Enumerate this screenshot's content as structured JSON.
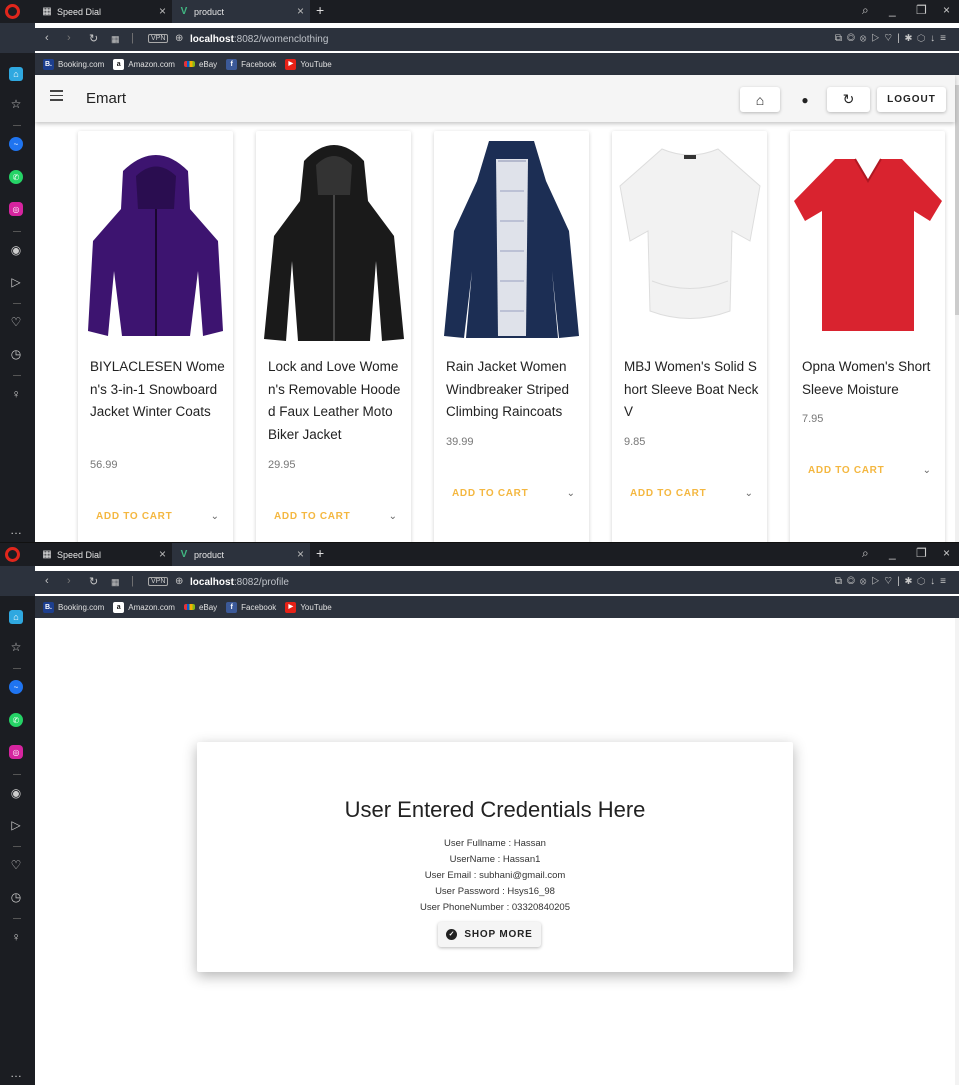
{
  "browser": {
    "tabs": [
      {
        "label": "Speed Dial"
      },
      {
        "label": "product"
      }
    ],
    "bookmarks": [
      {
        "label": "Booking.com",
        "icon": "booking-icon",
        "badge": "B.",
        "color": "#1d3f8f"
      },
      {
        "label": "Amazon.com",
        "icon": "amazon-icon",
        "badge": "a",
        "color": "#ffffff"
      },
      {
        "label": "eBay",
        "icon": "ebay-icon",
        "badge": "",
        "color": "#e2c018"
      },
      {
        "label": "Facebook",
        "icon": "facebook-icon",
        "badge": "f",
        "color": "#3b5998"
      },
      {
        "label": "YouTube",
        "icon": "youtube-icon",
        "badge": "▶",
        "color": "#e62117"
      }
    ]
  },
  "screen1": {
    "url_host": "localhost",
    "url_path": ":8082/womenclothing",
    "appbar": {
      "title": "Emart",
      "logout_label": "LOGOUT"
    },
    "products": [
      {
        "title": "BIYLACLESEN Women's 3-in-1 Snowboard Jacket Winter Coats",
        "price": "56.99",
        "cart_label": "ADD TO CART",
        "image": "purple-jacket"
      },
      {
        "title": "Lock and Love Women's Removable Hooded Faux Leather Moto Biker Jacket",
        "price": "29.95",
        "cart_label": "ADD TO CART",
        "image": "black-leather-jacket"
      },
      {
        "title": "Rain Jacket Women Windbreaker Striped Climbing Raincoats",
        "price": "39.99",
        "cart_label": "ADD TO CART",
        "image": "navy-rain-jacket"
      },
      {
        "title": "MBJ Women's Solid Short Sleeve Boat Neck V",
        "price": "9.85",
        "cart_label": "ADD TO CART",
        "image": "white-top"
      },
      {
        "title": "Opna Women's Short Sleeve Moisture",
        "price": "7.95",
        "cart_label": "ADD TO CART",
        "image": "red-tshirt"
      }
    ]
  },
  "screen2": {
    "url_host": "localhost",
    "url_path": ":8082/profile",
    "card": {
      "heading": "User Entered Credentials Here",
      "fullname": "User Fullname : Hassan",
      "username": "UserName : Hassan1",
      "email": "User Email : subhani@gmail.com",
      "password": "User Password : Hsys16_98",
      "phone": "User PhoneNumber : 03320840205",
      "button_label": "SHOP MORE"
    }
  }
}
